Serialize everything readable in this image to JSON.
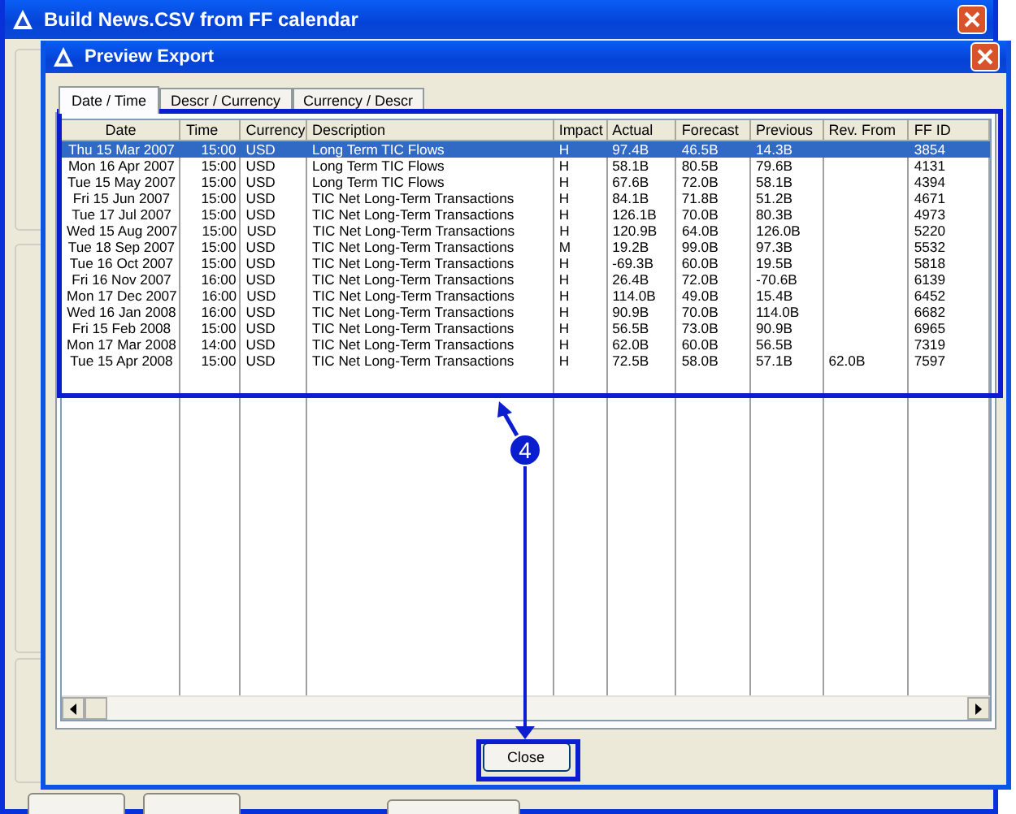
{
  "window": {
    "title": "Build News.CSV from FF calendar"
  },
  "dialog": {
    "title": "Preview Export",
    "tabs": [
      {
        "label": "Date / Time",
        "selected": true
      },
      {
        "label": "Descr / Currency",
        "selected": false
      },
      {
        "label": "Currency / Descr",
        "selected": false
      }
    ],
    "table": {
      "columns": [
        "Date",
        "Time",
        "Currency",
        "Description",
        "Impact",
        "Actual",
        "Forecast",
        "Previous",
        "Rev. From",
        "FF ID"
      ],
      "rows": [
        {
          "cells": [
            "Thu 15 Mar 2007",
            "15:00",
            "USD",
            "Long Term TIC Flows",
            "H",
            "97.4B",
            "46.5B",
            "14.3B",
            "",
            "3854"
          ],
          "selected": true
        },
        {
          "cells": [
            "Mon 16 Apr 2007",
            "15:00",
            "USD",
            "Long Term TIC Flows",
            "H",
            "58.1B",
            "80.5B",
            "79.6B",
            "",
            "4131"
          ],
          "selected": false
        },
        {
          "cells": [
            "Tue 15 May 2007",
            "15:00",
            "USD",
            "Long Term TIC Flows",
            "H",
            "67.6B",
            "72.0B",
            "58.1B",
            "",
            "4394"
          ],
          "selected": false
        },
        {
          "cells": [
            "Fri 15 Jun 2007",
            "15:00",
            "USD",
            "TIC Net Long-Term Transactions",
            "H",
            "84.1B",
            "71.8B",
            "51.2B",
            "",
            "4671"
          ],
          "selected": false
        },
        {
          "cells": [
            "Tue 17 Jul 2007",
            "15:00",
            "USD",
            "TIC Net Long-Term Transactions",
            "H",
            "126.1B",
            "70.0B",
            "80.3B",
            "",
            "4973"
          ],
          "selected": false
        },
        {
          "cells": [
            "Wed 15 Aug 2007",
            "15:00",
            "USD",
            "TIC Net Long-Term Transactions",
            "H",
            "120.9B",
            "64.0B",
            "126.0B",
            "",
            "5220"
          ],
          "selected": false
        },
        {
          "cells": [
            "Tue 18 Sep 2007",
            "15:00",
            "USD",
            "TIC Net Long-Term Transactions",
            "M",
            "19.2B",
            "99.0B",
            "97.3B",
            "",
            "5532"
          ],
          "selected": false
        },
        {
          "cells": [
            "Tue 16 Oct 2007",
            "15:00",
            "USD",
            "TIC Net Long-Term Transactions",
            "H",
            "-69.3B",
            "60.0B",
            "19.5B",
            "",
            "5818"
          ],
          "selected": false
        },
        {
          "cells": [
            "Fri 16 Nov 2007",
            "16:00",
            "USD",
            "TIC Net Long-Term Transactions",
            "H",
            "26.4B",
            "72.0B",
            "-70.6B",
            "",
            "6139"
          ],
          "selected": false
        },
        {
          "cells": [
            "Mon 17 Dec 2007",
            "16:00",
            "USD",
            "TIC Net Long-Term Transactions",
            "H",
            "114.0B",
            "49.0B",
            "15.4B",
            "",
            "6452"
          ],
          "selected": false
        },
        {
          "cells": [
            "Wed 16 Jan 2008",
            "16:00",
            "USD",
            "TIC Net Long-Term Transactions",
            "H",
            "90.9B",
            "70.0B",
            "114.0B",
            "",
            "6682"
          ],
          "selected": false
        },
        {
          "cells": [
            "Fri 15 Feb 2008",
            "15:00",
            "USD",
            "TIC Net Long-Term Transactions",
            "H",
            "56.5B",
            "73.0B",
            "90.9B",
            "",
            "6965"
          ],
          "selected": false
        },
        {
          "cells": [
            "Mon 17 Mar 2008",
            "14:00",
            "USD",
            "TIC Net Long-Term Transactions",
            "H",
            "62.0B",
            "60.0B",
            "56.5B",
            "",
            "7319"
          ],
          "selected": false
        },
        {
          "cells": [
            "Tue 15 Apr 2008",
            "15:00",
            "USD",
            "TIC Net Long-Term Transactions",
            "H",
            "72.5B",
            "58.0B",
            "57.1B",
            "62.0B",
            "7597"
          ],
          "selected": false
        }
      ]
    },
    "buttons": [
      "Close"
    ]
  },
  "annotation": {
    "label": "4"
  }
}
